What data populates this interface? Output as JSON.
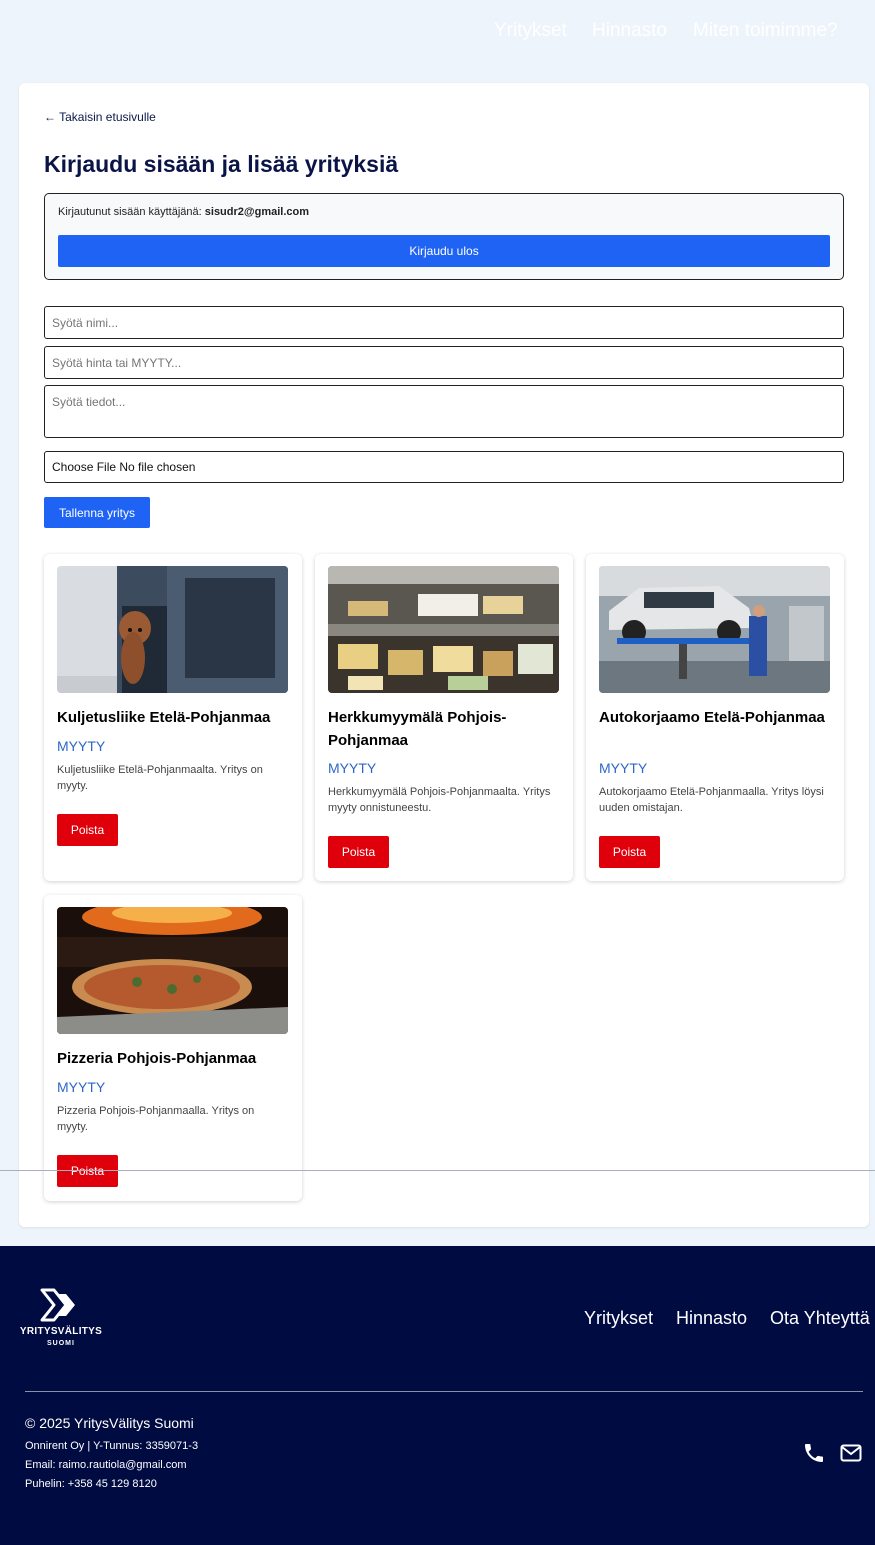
{
  "nav": {
    "items": [
      "Yritykset",
      "Hinnasto",
      "Miten toimimme?"
    ]
  },
  "main": {
    "back_link": "← Takaisin etusivulle",
    "title": "Kirjaudu sisään ja lisää yrityksiä",
    "login": {
      "info_prefix": "Kirjautunut sisään käyttäjänä: ",
      "email": "sisudr2@gmail.com",
      "logout_label": "Kirjaudu ulos"
    },
    "form": {
      "name_placeholder": "Syötä nimi...",
      "price_placeholder": "Syötä hinta tai MYYTY...",
      "info_placeholder": "Syötä tiedot...",
      "file_button": "Choose File",
      "file_status": "No file chosen",
      "save_label": "Tallenna yritys"
    },
    "cards": [
      {
        "name": "Kuljetusliike Etelä-Pohjanmaa",
        "status": "MYYTY",
        "description": "Kuljetusliike Etelä-Pohjanmaalta. Yritys on myyty.",
        "delete_label": "Poista",
        "image": "truck-with-dog-photo"
      },
      {
        "name": "Herkkumyymälä Pohjois-Pohjanmaa",
        "status": "MYYTY",
        "description": "Herkkumyymälä Pohjois-Pohjanmaalta. Yritys myyty onnistuneestu.",
        "delete_label": "Poista",
        "image": "deli-counter-photo"
      },
      {
        "name": "Autokorjaamo Etelä-Pohjanmaa",
        "status": "MYYTY",
        "description": "Autokorjaamo Etelä-Pohjanmaalla. Yritys löysi uuden omistajan.",
        "delete_label": "Poista",
        "image": "car-repair-shop-photo"
      },
      {
        "name": "Pizzeria Pohjois-Pohjanmaa",
        "status": "MYYTY",
        "description": "Pizzeria Pohjois-Pohjanmaalla. Yritys on myyty.",
        "delete_label": "Poista",
        "image": "pizza-oven-photo"
      }
    ]
  },
  "footer": {
    "logo_text": "YRITYSVÄLITYS",
    "logo_subtext": "SUOMI",
    "links": [
      "Yritykset",
      "Hinnasto",
      "Ota Yhteyttä"
    ],
    "copyright": "© 2025 YritysVälitys Suomi",
    "company": "Onnirent Oy | Y-Tunnus: 3359071-3",
    "email": "Email: raimo.rautiola@gmail.com",
    "phone": "Puhelin: +358 45 129 8120",
    "icons": [
      "phone-icon",
      "mail-icon"
    ]
  },
  "colors": {
    "primary_blue": "#1f63f5",
    "delete_red": "#e0000b",
    "status_blue": "#2e67c9",
    "footer_bg": "#000b42",
    "page_bg": "#eef4fb"
  }
}
